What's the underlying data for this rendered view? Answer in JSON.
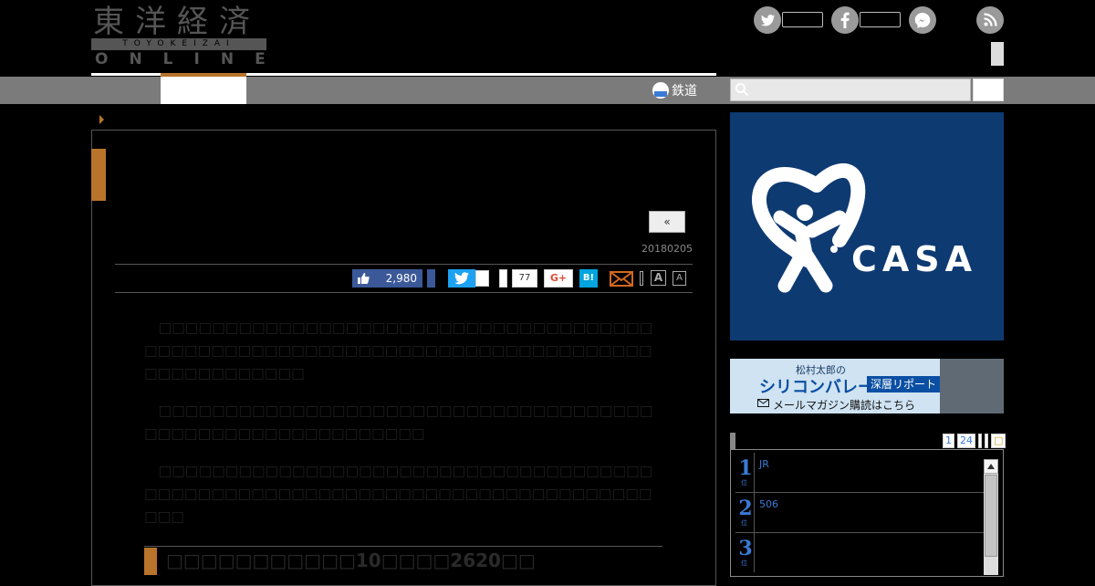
{
  "header": {
    "logo_kanji": "東洋経済",
    "logo_romaji": "TOYOKEIZAI",
    "logo_online": "ONLINE"
  },
  "nav": {
    "rail_label": "鉄道"
  },
  "article": {
    "prev_label": "«",
    "date": "20180205",
    "like_count": "2,980",
    "share_count": "77",
    "gplus_label": "G+",
    "hatena_label": "B!",
    "font_large": "A",
    "font_small": "A",
    "para1": "　□□□□□□□□□□□□□□□□□□□□□□□□□□□□□□□□□□□□□□□□□□□□□□□□□□□□□□□□□□□□□□□□□□□□□□□□□□□□□□□□□□□□□□□",
    "para2": "　□□□□□□□□□□□□□□□□□□□□□□□□□□□□□□□□□□□□□□□□□□□□□□□□□□□□□□□□□□",
    "para3": "　□□□□□□□□□□□□□□□□□□□□□□□□□□□□□□□□□□□□□□□□□□□□□□□□□□□□□□□□□□□□□□□□□□□□□□□□□□□□□□",
    "section_heading": "□□□□□□□□□□□10□□□□2620□□"
  },
  "sidebar": {
    "ad_casa_text": "CASA",
    "ad_sv_author": "松村太郎の",
    "ad_sv_title": "シリコンバレー",
    "ad_sv_badge": "深層リポート",
    "ad_sv_cta": "メールマガジン購読はこちら",
    "ranking_tabs": [
      "1",
      "24",
      "",
      "",
      "□"
    ],
    "ranking": [
      {
        "rank": "1",
        "unit": "位",
        "text": "JR"
      },
      {
        "rank": "2",
        "unit": "位",
        "text": "506"
      },
      {
        "rank": "3",
        "unit": "位",
        "text": ""
      }
    ]
  },
  "colors": {
    "accent": "#b8742a",
    "nav_bg": "#7b7b7b",
    "link": "#3a7bd5",
    "casa_bg": "#0e3a72"
  }
}
